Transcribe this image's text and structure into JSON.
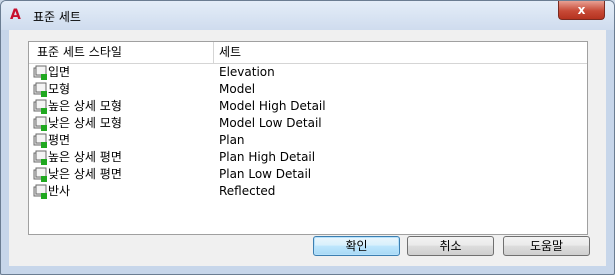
{
  "window": {
    "title": "표준 세트",
    "app_icon": "A",
    "close_glyph": "x"
  },
  "table": {
    "columns": [
      "표준 세트 스타일",
      "세트"
    ],
    "rows": [
      {
        "name": "입면",
        "set": "Elevation"
      },
      {
        "name": "모형",
        "set": "Model"
      },
      {
        "name": "높은 상세 모형",
        "set": "Model High Detail"
      },
      {
        "name": "낮은 상세 모형",
        "set": "Model Low Detail"
      },
      {
        "name": "평면",
        "set": "Plan"
      },
      {
        "name": "높은 상세 평면",
        "set": "Plan High Detail"
      },
      {
        "name": "낮은 상세 평면",
        "set": "Plan Low Detail"
      },
      {
        "name": "반사",
        "set": "Reflected"
      }
    ]
  },
  "buttons": {
    "ok": "확인",
    "cancel": "취소",
    "help": "도움말"
  }
}
